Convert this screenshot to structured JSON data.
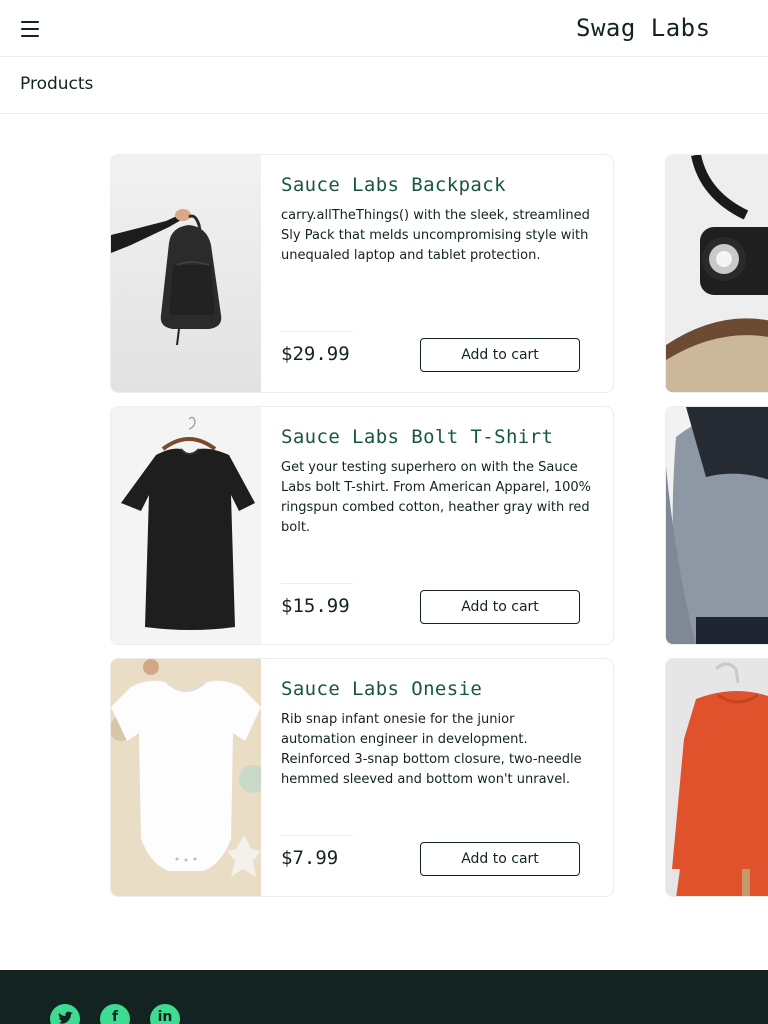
{
  "header": {
    "menu_icon": "hamburger-menu-icon",
    "title": "Swag Labs"
  },
  "subheader": {
    "title": "Products"
  },
  "products": [
    {
      "name": "Sauce Labs Backpack",
      "description": "carry.allTheThings() with the sleek, streamlined Sly Pack that melds uncompromising style with unequaled laptop and tablet protection.",
      "price": "$29.99",
      "button": "Add to cart"
    },
    {
      "name": "Sauce Labs Bolt T-Shirt",
      "description": "Get your testing superhero on with the Sauce Labs bolt T-shirt. From American Apparel, 100% ringspun combed cotton, heather gray with red bolt.",
      "price": "$15.99",
      "button": "Add to cart"
    },
    {
      "name": "Sauce Labs Onesie",
      "description": "Rib snap infant onesie for the junior automation engineer in development. Reinforced 3-snap bottom closure, two-needle hemmed sleeved and bottom won't unravel.",
      "price": "$7.99",
      "button": "Add to cart"
    }
  ],
  "footer": {
    "social_icons": [
      "twitter-icon",
      "facebook-icon",
      "linkedin-icon"
    ],
    "background_color": "#132322",
    "icon_color": "#3ddc91"
  },
  "colors": {
    "product_name": "#18583a",
    "text": "#132322",
    "border": "#ededed"
  }
}
